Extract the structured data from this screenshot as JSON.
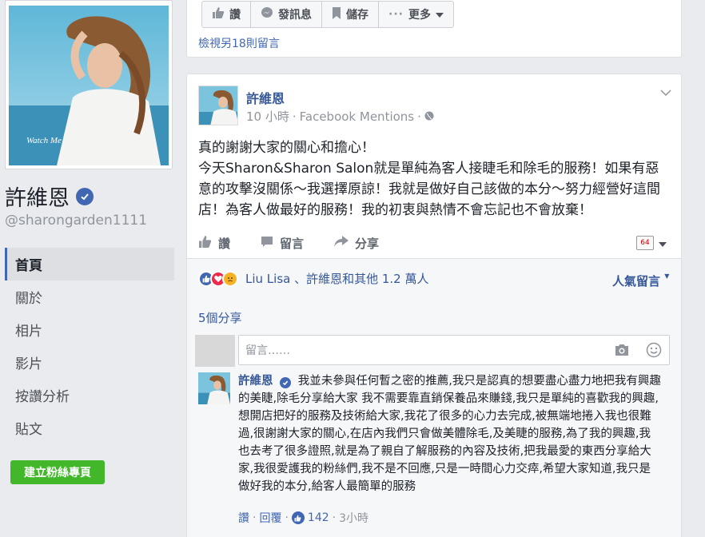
{
  "profile": {
    "photo_caption": "Watch Me",
    "name": "許維恩",
    "handle": "@sharongarden1111"
  },
  "side_nav": [
    {
      "label": "首頁"
    },
    {
      "label": "關於"
    },
    {
      "label": "相片"
    },
    {
      "label": "影片"
    },
    {
      "label": "按讚分析"
    },
    {
      "label": "貼文"
    }
  ],
  "create_page_label": "建立粉絲專頁",
  "top_actions": {
    "like": "讚",
    "message": "發訊息",
    "save": "儲存",
    "more": "更多"
  },
  "more_comments_label": "檢視另18則留言",
  "post": {
    "author": "許維恩",
    "time": "10 小時",
    "source": "Facebook Mentions",
    "body": [
      "真的謝謝大家的關心和擔心！",
      "今天Sharon&Sharon Salon就是單純為客人接睫毛和除毛的服務！如果有惡意的攻擊沒關係～我選擇原諒！我就是做好自己該做的本分～努力經營好這間店！為客人做最好的服務！我的初衷與熱情不會忘記也不會放棄！"
    ],
    "actions": {
      "like": "讚",
      "comment": "留言",
      "share": "分享"
    },
    "reader_icon_text": "64",
    "reactions_text": "Liu Lisa 、許維恩和其他 1.2 萬人",
    "sort_label": "人氣留言",
    "shares_label": "5個分享",
    "comment_placeholder": "留言……"
  },
  "reply": {
    "author": "許維恩",
    "text": "我並未參與任何暫之密的推薦,我只是認真的想要盡心盡力地把我有興趣的美睫,除毛分享給大家 我不需要靠直銷保養品來賺錢,我只是單純的喜歡我的興趣,想開店把好的服務及技術給大家,我花了很多的心力去完成,被無端地捲入我也很難過,很謝謝大家的關心,在店內我們只會做美體除毛,及美睫的服務,為了我的興趣,我也去考了很多證照,就是為了親自了解服務的內容及技術,把我最愛的東西分享給大家,我很愛護我的粉絲們,我不是不回應,只是一時間心力交瘁,希望大家知道,我只是做好我的本分,給客人最簡單的服務",
    "like_label": "讚",
    "reply_label": "回覆",
    "like_count": "142",
    "time": "3小時"
  },
  "colors": {
    "brand_blue": "#4267b2",
    "link_blue": "#365899",
    "green": "#42b72a"
  }
}
